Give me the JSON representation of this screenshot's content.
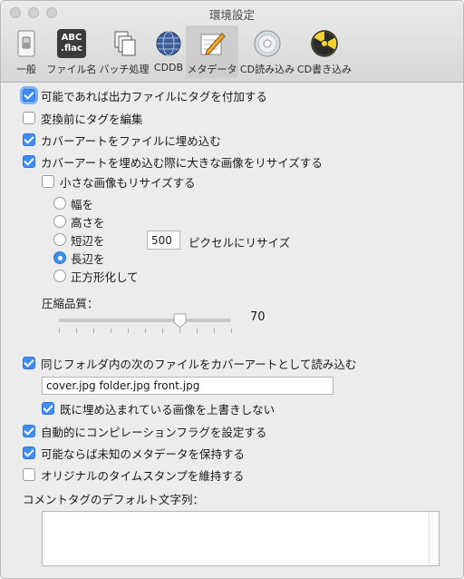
{
  "window": {
    "title": "環境設定"
  },
  "toolbar": {
    "items": [
      {
        "label": "一般",
        "icon": "switch-icon"
      },
      {
        "label": "ファイル名",
        "icon": "abc-flac-icon",
        "icon_text_1": "ABC",
        "icon_text_2": ".flac"
      },
      {
        "label": "バッチ処理",
        "icon": "documents-icon"
      },
      {
        "label": "CDDB",
        "icon": "globe-icon"
      },
      {
        "label": "メタデータ",
        "icon": "pencil-icon",
        "selected": true
      },
      {
        "label": "CD読み込み",
        "icon": "cd-icon"
      },
      {
        "label": "CD書き込み",
        "icon": "burn-icon"
      }
    ]
  },
  "options": {
    "write_tags": {
      "label": "可能であれば出力ファイルにタグを付加する",
      "checked": true
    },
    "edit_tags_before_convert": {
      "label": "変換前にタグを編集",
      "checked": false
    },
    "embed_cover_art": {
      "label": "カバーアートをファイルに埋め込む",
      "checked": true
    },
    "resize_large_images": {
      "label": "カバーアートを埋め込む際に大きな画像をリサイズする",
      "checked": true
    },
    "resize_small_images": {
      "label": "小さな画像もリサイズする",
      "checked": false
    }
  },
  "resize_mode": {
    "options": [
      "幅を",
      "高さを",
      "短辺を",
      "長辺を",
      "正方形化して"
    ],
    "selected": "長辺を",
    "pixel_value": "500",
    "pixel_suffix": "ピクセルにリサイズ"
  },
  "compression": {
    "label": "圧縮品質：",
    "value": "70",
    "level": 70,
    "min": 0,
    "max": 100
  },
  "load_cover": {
    "label": "同じフォルダ内の次のファイルをカバーアートとして読み込む",
    "checked": true,
    "filenames": "cover.jpg folder.jpg front.jpg",
    "overwrite": {
      "label": "既に埋め込まれている画像を上書きしない",
      "checked": true
    }
  },
  "compilation_flag": {
    "label": "自動的にコンピレーションフラグを設定する",
    "checked": true
  },
  "keep_unknown_metadata": {
    "label": "可能ならば未知のメタデータを保持する",
    "checked": true
  },
  "keep_timestamp": {
    "label": "オリジナルのタイムスタンプを維持する",
    "checked": false
  },
  "comment": {
    "label": "コメントタグのデフォルト文字列：",
    "value": ""
  }
}
